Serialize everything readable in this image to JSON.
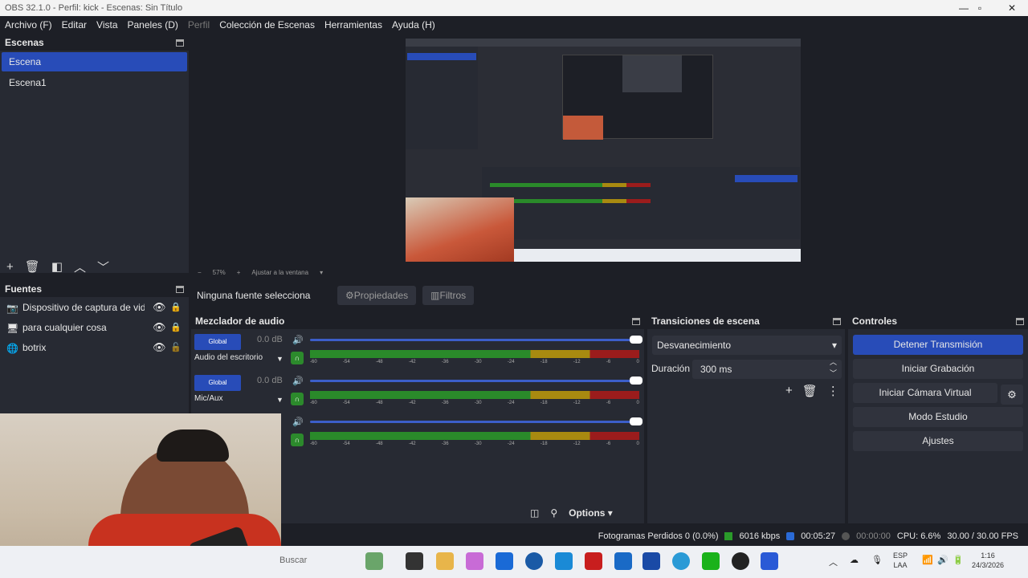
{
  "window": {
    "title": "OBS 32.1.0 - Perfil: kick - Escenas: Sin Título"
  },
  "menu": [
    {
      "label": "Archivo (F)",
      "enabled": true
    },
    {
      "label": "Editar",
      "enabled": true
    },
    {
      "label": "Vista",
      "enabled": true
    },
    {
      "label": "Paneles (D)",
      "enabled": true
    },
    {
      "label": "Perfil",
      "enabled": false
    },
    {
      "label": "Colección de Escenas",
      "enabled": true
    },
    {
      "label": "Herramientas",
      "enabled": true
    },
    {
      "label": "Ayuda (H)",
      "enabled": true
    }
  ],
  "scenes": {
    "title": "Escenas",
    "items": [
      "Escena",
      "Escena1"
    ],
    "selected": "Escena"
  },
  "sources": {
    "title": "Fuentes",
    "items": [
      {
        "label": "Dispositivo de captura de video",
        "icon": "camera-icon"
      },
      {
        "label": "para cualquier cosa",
        "icon": "monitor-icon"
      },
      {
        "label": "botrix",
        "icon": "globe-icon"
      }
    ]
  },
  "preview_bar": {
    "zoom": "57%",
    "fit": "Ajustar a la ventana"
  },
  "propbar": {
    "nosel": "Ninguna fuente selecciona",
    "properties": "Propiedades",
    "filters": "Filtros"
  },
  "mixer": {
    "title": "Mezclador de audio",
    "channels": [
      {
        "global": "Global",
        "db": "0.0 dB",
        "name": "Audio del escritorio"
      },
      {
        "global": "Global",
        "db": "0.0 dB",
        "name": "Mic/Aux"
      },
      {
        "global": "",
        "db": "",
        "name": ""
      }
    ],
    "ticks": [
      "-60",
      "-54",
      "-48",
      "-42",
      "-36",
      "-30",
      "-24",
      "-18",
      "-12",
      "-6",
      "0"
    ],
    "options": "Options"
  },
  "transitions": {
    "title": "Transiciones de escena",
    "selected": "Desvanecimiento",
    "duration_label": "Duración",
    "duration": "300 ms"
  },
  "controls": {
    "title": "Controles",
    "stop_stream": "Detener Transmisión",
    "start_record": "Iniciar Grabación",
    "virtual_cam": "Iniciar Cámara Virtual",
    "studio_mode": "Modo Estudio",
    "settings": "Ajustes"
  },
  "status": {
    "dropped": "Fotogramas Perdidos 0 (0.0%)",
    "bitrate": "6016 kbps",
    "stream_time": "00:05:27",
    "rec_time": "00:00:00",
    "cpu": "CPU: 6.6%",
    "fps": "30.00 / 30.00 FPS"
  },
  "taskbar": {
    "search": "Buscar",
    "lang1": "ESP",
    "lang2": "LAA",
    "time": "1:16",
    "date": "24/3/2026"
  },
  "colors": {
    "accent": "#284cb8",
    "green": "#2a8a2a",
    "yellow": "#a88a10",
    "red": "#9b1c1c"
  }
}
